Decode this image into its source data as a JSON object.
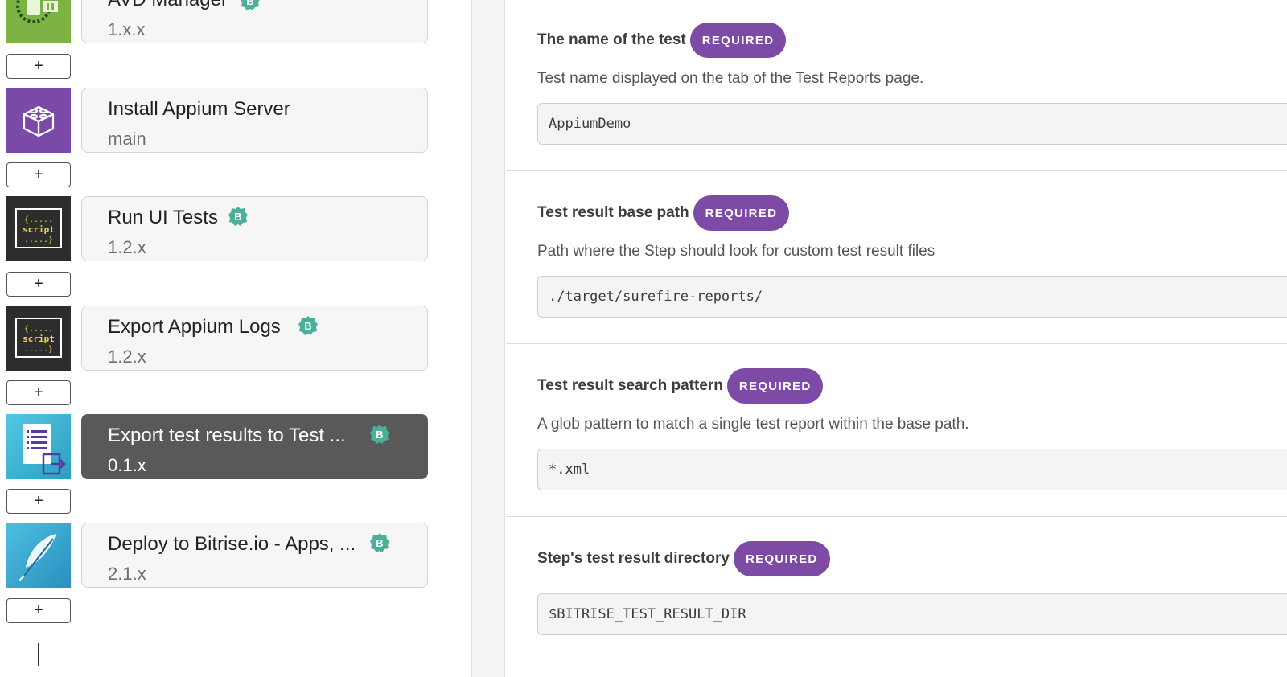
{
  "steps": [
    {
      "title": "AVD Manager",
      "version": "1.x.x",
      "badge": "B",
      "icon": "avd-manager-icon"
    },
    {
      "title": "Install Appium Server",
      "version": "main",
      "badge": "",
      "icon": "lego-brick-icon"
    },
    {
      "title": "Run UI Tests",
      "version": "1.2.x",
      "badge": "B",
      "icon": "script-icon"
    },
    {
      "title": "Export Appium Logs",
      "version": "1.2.x",
      "badge": "B",
      "icon": "script-icon"
    },
    {
      "title": "Export test results to Test ...",
      "version": "0.1.x",
      "badge": "B",
      "icon": "export-test-results-icon"
    },
    {
      "title": "Deploy to Bitrise.io - Apps, ...",
      "version": "2.1.x",
      "badge": "B",
      "icon": "feather-icon"
    }
  ],
  "add_button_label": "+",
  "script_icon_text": {
    "line1": "{.....",
    "line2": "script",
    "line3": ".....}"
  },
  "inputs": [
    {
      "label": "The name of the test",
      "required": "REQUIRED",
      "description": "Test name displayed on the tab of the Test Reports page.",
      "value": "AppiumDemo"
    },
    {
      "label": "Test result base path",
      "required": "REQUIRED",
      "description": "Path where the Step should look for custom test result files",
      "value": "./target/surefire-reports/"
    },
    {
      "label": "Test result search pattern",
      "required": "REQUIRED",
      "description": "A glob pattern to match a single test report within the base path.",
      "value": "*.xml"
    },
    {
      "label": "Step's test result directory",
      "required": "REQUIRED",
      "description": "",
      "value": "$BITRISE_TEST_RESULT_DIR"
    }
  ],
  "colors": {
    "required_pill": "#7d4ba5",
    "badge_verified": "#4caf9a",
    "active_step": "#595959",
    "avd_icon_bg": "#7cb342",
    "appium_icon_bg": "#7b4aa8",
    "script_icon_bg": "#2d2d2d",
    "export_icon_bg": "#38b8d6",
    "deploy_icon_bg": "#3aa8cf"
  }
}
